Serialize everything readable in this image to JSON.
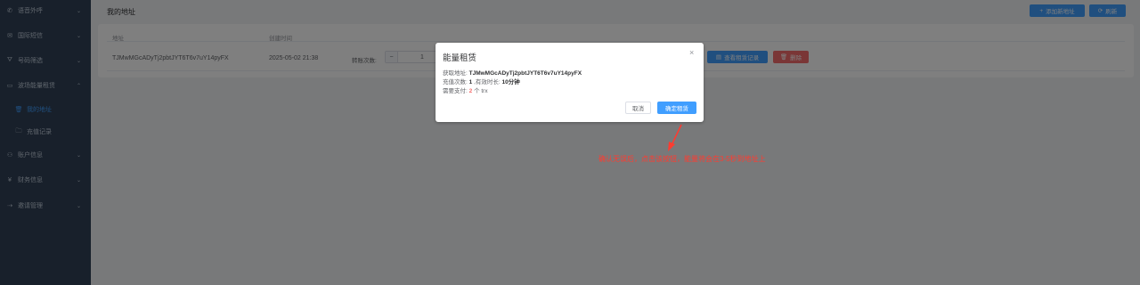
{
  "sidebar": {
    "items": [
      {
        "label": "语音外呼",
        "icon": "phone-icon",
        "glyph": "✆",
        "chevron": "⌄"
      },
      {
        "label": "国际短信",
        "icon": "mail-icon",
        "glyph": "✉",
        "chevron": "⌄"
      },
      {
        "label": "号码筛选",
        "icon": "filter-icon",
        "glyph": "⛛",
        "chevron": "⌄"
      },
      {
        "label": "波场能量租赁",
        "icon": "wallet-icon",
        "glyph": "▭",
        "chevron": "⌃"
      },
      {
        "label": "我的地址",
        "icon": "trash-icon",
        "glyph": "🗑"
      },
      {
        "label": "充值记录",
        "icon": "folder-icon",
        "glyph": "🗀"
      },
      {
        "label": "账户信息",
        "icon": "user-icon",
        "glyph": "⚇",
        "chevron": "⌄"
      },
      {
        "label": "财务信息",
        "icon": "finance-icon",
        "glyph": "¥",
        "chevron": "⌄"
      },
      {
        "label": "邀请管理",
        "icon": "share-icon",
        "glyph": "⇢",
        "chevron": "⌄"
      }
    ]
  },
  "header": {
    "title": "我的地址",
    "add_button": "添加新地址",
    "add_icon": "+",
    "refresh_button": "刷新",
    "refresh_icon": "⟳"
  },
  "table": {
    "columns": [
      "地址",
      "创建时间"
    ],
    "row": {
      "address": "TJMwMGcADyTj2pbtJYT6T6v7uY14pyFX",
      "created": "2025-05-02 21:38",
      "count_label": "转账次数:",
      "count_minus": "−",
      "count_value": "1",
      "records_button": "查看租赁记录",
      "records_icon": "▤",
      "delete_button": "删除",
      "delete_icon": "🗑"
    }
  },
  "dialog": {
    "title": "能量租赁",
    "close": "×",
    "address_label": "获取地址:",
    "address_value": "TJMwMGcADyTj2pbtJYT6T6v7uY14pyFX",
    "count_label": "充值次数:",
    "count_value": "1",
    "duration_label": ",有效时长:",
    "duration_value": "10分钟",
    "pay_label": "需要支付:",
    "pay_value": "2",
    "pay_unit": "个 trx",
    "cancel_button": "取消",
    "confirm_button": "确定租赁"
  },
  "annotation": {
    "text": "确认无误后，点击该按钮，能量将会在3-5秒到地址上"
  },
  "colors": {
    "sidebar_bg": "#304156",
    "primary": "#409eff",
    "danger": "#f56c6c",
    "annotation": "#ff3b30"
  }
}
